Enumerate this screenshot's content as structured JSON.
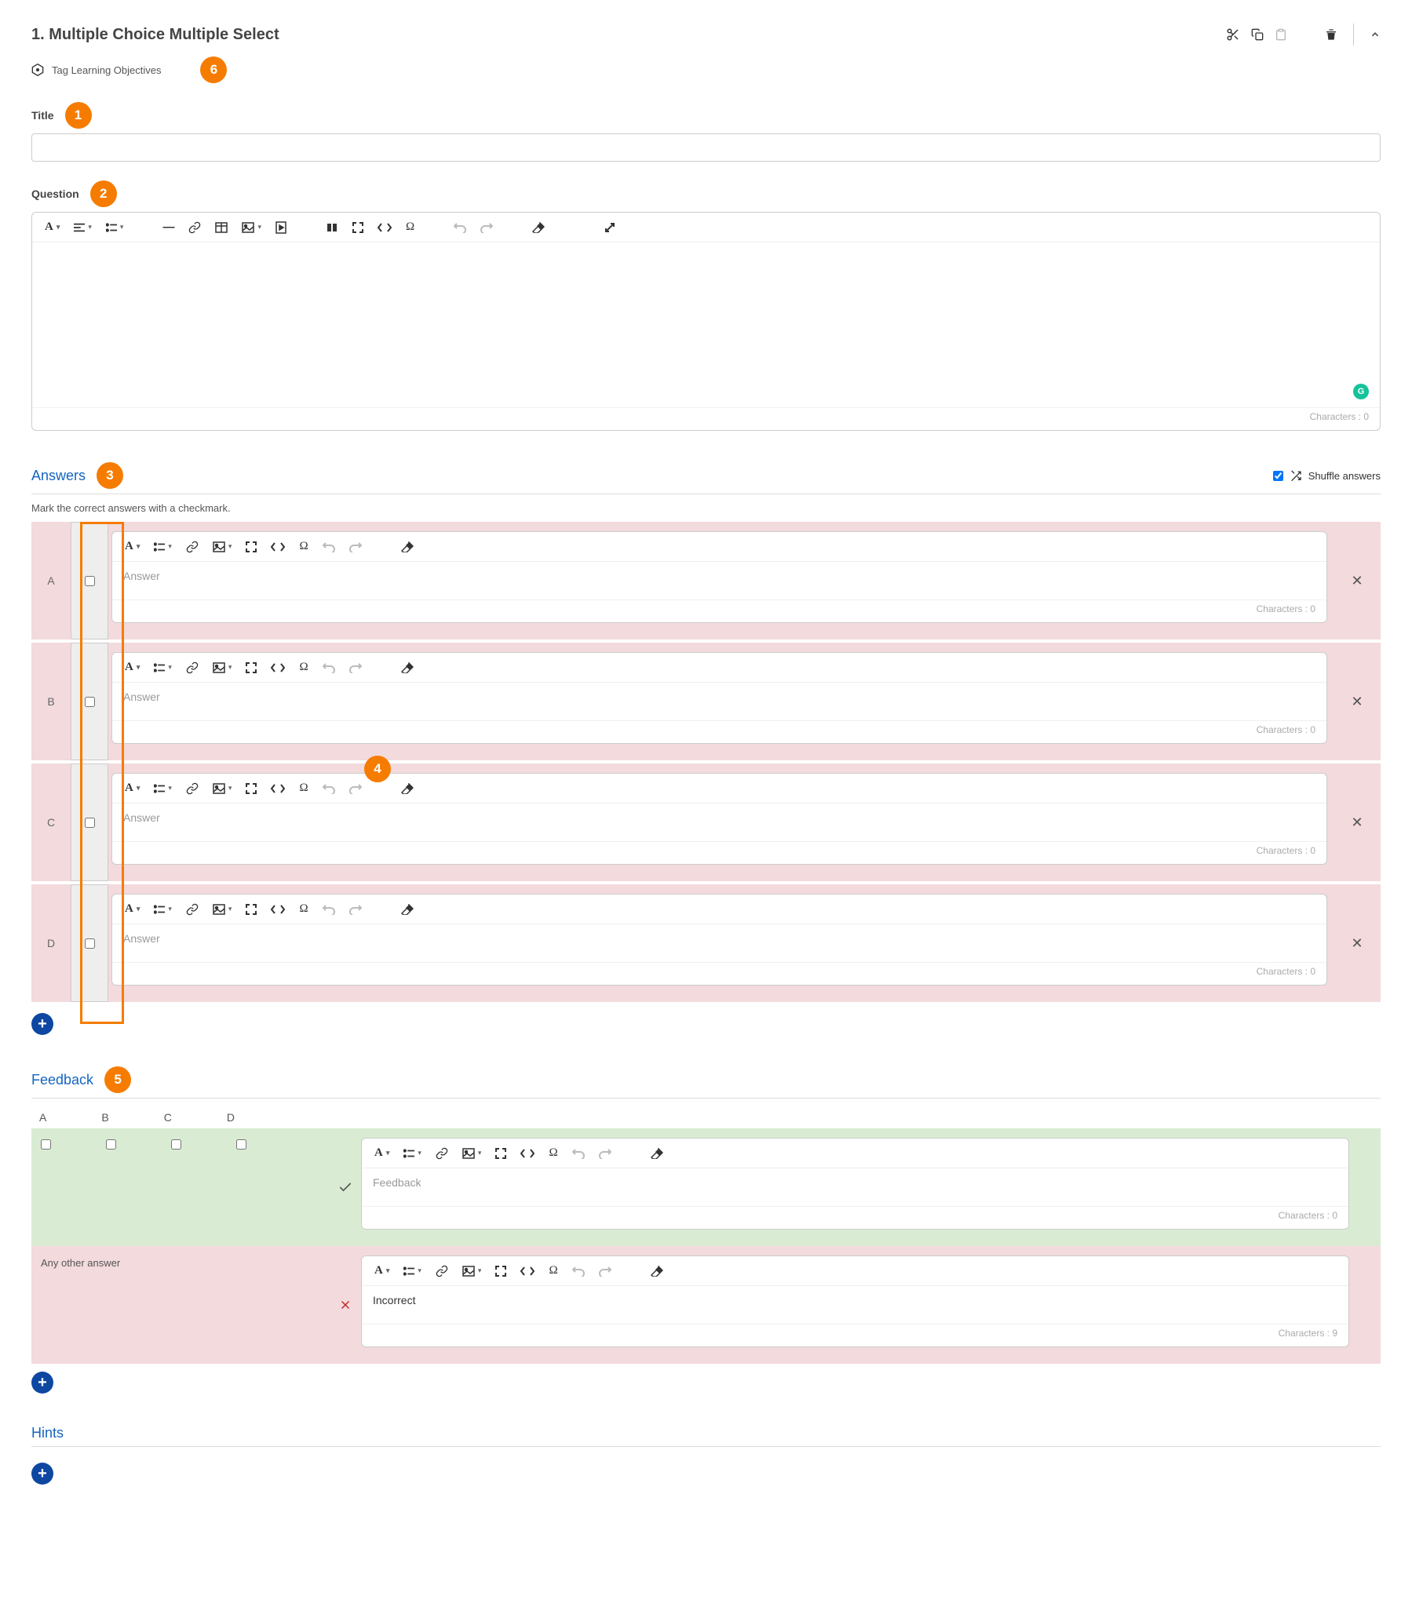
{
  "header": {
    "title": "1. Multiple Choice Multiple Select"
  },
  "tag": {
    "label": "Tag Learning Objectives"
  },
  "callouts": {
    "c1": "1",
    "c2": "2",
    "c3": "3",
    "c4": "4",
    "c5": "5",
    "c6": "6"
  },
  "title_section": {
    "label": "Title",
    "value": ""
  },
  "question_section": {
    "label": "Question",
    "characters_label": "Characters : 0"
  },
  "answers_section": {
    "heading": "Answers",
    "shuffle_label": "Shuffle answers",
    "shuffle_checked": true,
    "hint": "Mark the correct answers with a checkmark.",
    "placeholder": "Answer",
    "characters_label": "Characters : 0",
    "rows": [
      {
        "letter": "A"
      },
      {
        "letter": "B"
      },
      {
        "letter": "C"
      },
      {
        "letter": "D"
      }
    ]
  },
  "feedback_section": {
    "heading": "Feedback",
    "cols": [
      "A",
      "B",
      "C",
      "D"
    ],
    "correct_placeholder": "Feedback",
    "correct_chars": "Characters : 0",
    "any_other": "Any other answer",
    "incorrect_text": "Incorrect",
    "incorrect_chars": "Characters : 9"
  },
  "hints_section": {
    "heading": "Hints"
  }
}
